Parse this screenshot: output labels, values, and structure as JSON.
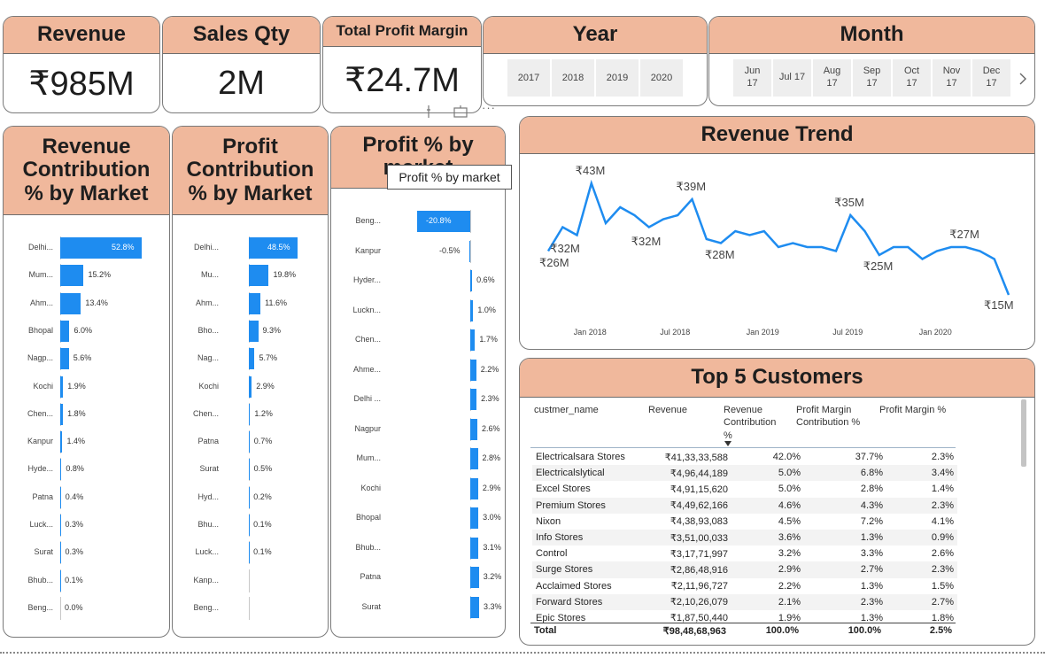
{
  "kpis": {
    "revenue": {
      "title": "Revenue",
      "value": "₹985M"
    },
    "sales_qty": {
      "title": "Sales Qty",
      "value": "2M"
    },
    "profit_margin": {
      "title": "Total Profit Margin",
      "value": "₹24.7M"
    }
  },
  "year_filter": {
    "title": "Year",
    "options": [
      "2017",
      "2018",
      "2019",
      "2020"
    ]
  },
  "month_filter": {
    "title": "Month",
    "options": [
      {
        "m": "Jun",
        "y": "17"
      },
      {
        "m": "Jul 17",
        "y": ""
      },
      {
        "m": "Aug",
        "y": "17"
      },
      {
        "m": "Sep",
        "y": "17"
      },
      {
        "m": "Oct",
        "y": "17"
      },
      {
        "m": "Nov",
        "y": "17"
      },
      {
        "m": "Dec",
        "y": "17"
      }
    ],
    "next_icon": "chevron-right-icon"
  },
  "visual_toolbar": {
    "icons": [
      "filter-icon",
      "focus-mode-icon",
      "more-options-icon"
    ],
    "more_label": "···"
  },
  "tooltip": "Profit % by market",
  "chart_data": [
    {
      "type": "bar",
      "orientation": "horizontal",
      "title": "Revenue Contribution % by Market",
      "categories": [
        "Delhi...",
        "Mum...",
        "Ahm...",
        "Bhopal",
        "Nagp...",
        "Kochi",
        "Chen...",
        "Kanpur",
        "Hyde...",
        "Patna",
        "Luck...",
        "Surat",
        "Bhub...",
        "Beng..."
      ],
      "values": [
        52.8,
        15.2,
        13.4,
        6.0,
        5.6,
        1.9,
        1.8,
        1.4,
        0.8,
        0.4,
        0.3,
        0.3,
        0.1,
        0.0
      ],
      "labels": [
        "52.8%",
        "15.2%",
        "13.4%",
        "6.0%",
        "5.6%",
        "1.9%",
        "1.8%",
        "1.4%",
        "0.8%",
        "0.4%",
        "0.3%",
        "0.3%",
        "0.1%",
        "0.0%"
      ],
      "color": "#1e8cf0"
    },
    {
      "type": "bar",
      "orientation": "horizontal",
      "title": "Profit Contribution % by Market",
      "categories": [
        "Delhi...",
        "Mu...",
        "Ahm...",
        "Bho...",
        "Nag...",
        "Kochi",
        "Chen...",
        "Patna",
        "Surat",
        "Hyd...",
        "Bhu...",
        "Luck...",
        "Kanp...",
        "Beng..."
      ],
      "values": [
        48.5,
        19.8,
        11.6,
        9.3,
        5.7,
        2.9,
        1.2,
        0.7,
        0.5,
        0.2,
        0.1,
        0.1,
        0.0,
        0.0
      ],
      "labels": [
        "48.5%",
        "19.8%",
        "11.6%",
        "9.3%",
        "5.7%",
        "2.9%",
        "1.2%",
        "0.7%",
        "0.5%",
        "0.2%",
        "0.1%",
        "0.1%",
        "",
        ""
      ],
      "color": "#1e8cf0"
    },
    {
      "type": "bar",
      "orientation": "horizontal",
      "title": "Profit % by market",
      "categories": [
        "Beng...",
        "Kanpur",
        "Hyder...",
        "Luckn...",
        "Chen...",
        "Ahme...",
        "Delhi ...",
        "Nagpur",
        "Mum...",
        "Kochi",
        "Bhopal",
        "Bhub...",
        "Patna",
        "Surat"
      ],
      "values": [
        -20.8,
        -0.5,
        0.6,
        1.0,
        1.7,
        2.2,
        2.3,
        2.6,
        2.8,
        2.9,
        3.0,
        3.1,
        3.2,
        3.3
      ],
      "labels": [
        "-20.8%",
        "-0.5%",
        "0.6%",
        "1.0%",
        "1.7%",
        "2.2%",
        "2.3%",
        "2.6%",
        "2.8%",
        "2.9%",
        "3.0%",
        "3.1%",
        "3.2%",
        "3.3%"
      ],
      "color": "#1e8cf0"
    },
    {
      "type": "line",
      "title": "Revenue Trend",
      "x_tick_labels": [
        "Jan 2018",
        "Jul 2018",
        "Jan 2019",
        "Jul 2019",
        "Jan 2020"
      ],
      "x": [
        "2017-10",
        "2017-11",
        "2017-12",
        "2018-01",
        "2018-02",
        "2018-03",
        "2018-04",
        "2018-05",
        "2018-06",
        "2018-07",
        "2018-08",
        "2018-09",
        "2018-10",
        "2018-11",
        "2018-12",
        "2019-01",
        "2019-02",
        "2019-03",
        "2019-04",
        "2019-05",
        "2019-06",
        "2019-07",
        "2019-08",
        "2019-09",
        "2019-10",
        "2019-11",
        "2019-12",
        "2020-01",
        "2020-02",
        "2020-03",
        "2020-04",
        "2020-05",
        "2020-06"
      ],
      "values": [
        26,
        32,
        30,
        43,
        33,
        37,
        35,
        32,
        34,
        35,
        39,
        29,
        28,
        31,
        30,
        31,
        27,
        28,
        27,
        27,
        26,
        35,
        31,
        25,
        27,
        27,
        24,
        26,
        27,
        27,
        26,
        24,
        15
      ],
      "point_labels": [
        {
          "i": 0,
          "text": "₹26M"
        },
        {
          "i": 1,
          "text": "₹32M"
        },
        {
          "i": 3,
          "text": "₹43M"
        },
        {
          "i": 7,
          "text": "₹32M"
        },
        {
          "i": 10,
          "text": "₹39M"
        },
        {
          "i": 12,
          "text": "₹28M"
        },
        {
          "i": 21,
          "text": "₹35M"
        },
        {
          "i": 23,
          "text": "₹25M"
        },
        {
          "i": 29,
          "text": "₹27M"
        },
        {
          "i": 32,
          "text": "₹15M"
        }
      ],
      "color": "#1e8cf0"
    },
    {
      "type": "table",
      "title": "Top 5 Customers",
      "columns": [
        "custmer_name",
        "Revenue",
        "Revenue Contribution %",
        "Profit Margin Contribution %",
        "Profit Margin %"
      ],
      "rows": [
        [
          "Electricalsara Stores",
          "₹41,33,33,588",
          "42.0%",
          "37.7%",
          "2.3%"
        ],
        [
          "Electricalslytical",
          "₹4,96,44,189",
          "5.0%",
          "6.8%",
          "3.4%"
        ],
        [
          "Excel Stores",
          "₹4,91,15,620",
          "5.0%",
          "2.8%",
          "1.4%"
        ],
        [
          "Premium Stores",
          "₹4,49,62,166",
          "4.6%",
          "4.3%",
          "2.3%"
        ],
        [
          "Nixon",
          "₹4,38,93,083",
          "4.5%",
          "7.2%",
          "4.1%"
        ],
        [
          "Info Stores",
          "₹3,51,00,033",
          "3.6%",
          "1.3%",
          "0.9%"
        ],
        [
          "Control",
          "₹3,17,71,997",
          "3.2%",
          "3.3%",
          "2.6%"
        ],
        [
          "Surge Stores",
          "₹2,86,48,916",
          "2.9%",
          "2.7%",
          "2.3%"
        ],
        [
          "Acclaimed Stores",
          "₹2,11,96,727",
          "2.2%",
          "1.3%",
          "1.5%"
        ],
        [
          "Forward Stores",
          "₹2,10,26,079",
          "2.1%",
          "2.3%",
          "2.7%"
        ],
        [
          "Epic Stores",
          "₹1,87,50,440",
          "1.9%",
          "1.3%",
          "1.8%"
        ]
      ],
      "total": [
        "Total",
        "₹98,48,68,963",
        "100.0%",
        "100.0%",
        "2.5%"
      ],
      "sort_icon": "sort-desc-icon"
    }
  ]
}
